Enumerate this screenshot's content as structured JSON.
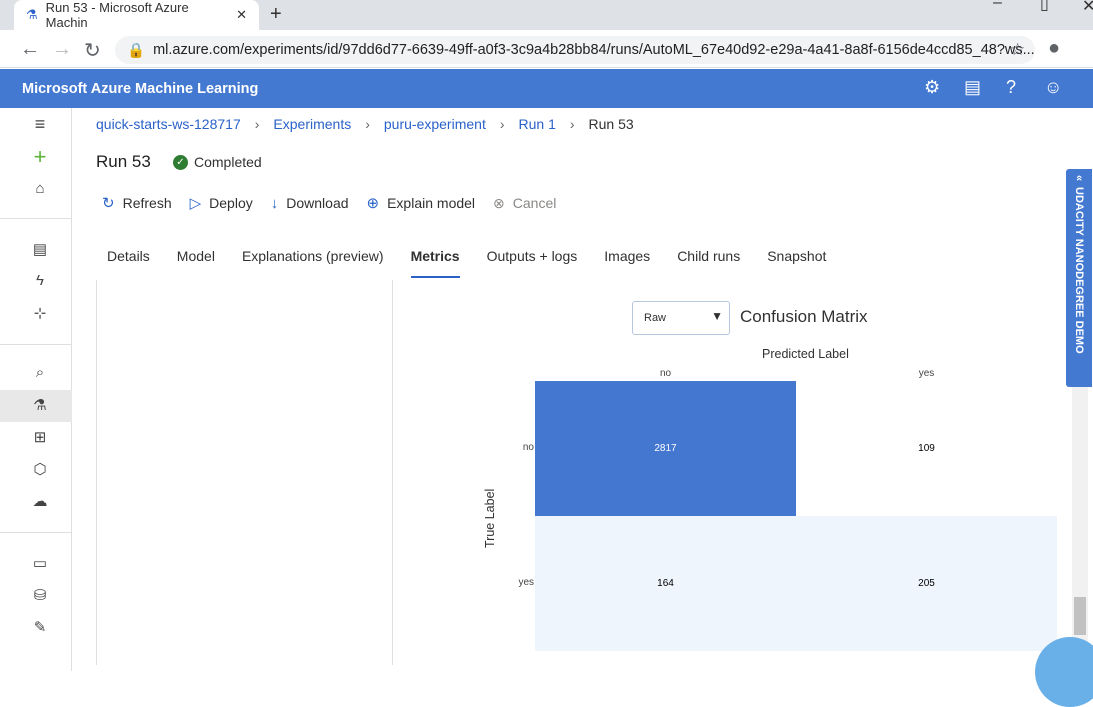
{
  "browser": {
    "tab_title": "Run 53 - Microsoft Azure Machin",
    "url": "ml.azure.com/experiments/id/97dd6d77-6639-49ff-a0f3-3c9a4b28bb84/runs/AutoML_67e40d92-e29a-4a41-8a8f-6156de4ccd85_48?ws..."
  },
  "app": {
    "title": "Microsoft Azure Machine Learning"
  },
  "breadcrumb": [
    "quick-starts-ws-128717",
    "Experiments",
    "puru-experiment",
    "Run 1",
    "Run 53"
  ],
  "run": {
    "title": "Run 53",
    "status": "Completed"
  },
  "toolbar": {
    "refresh": "Refresh",
    "deploy": "Deploy",
    "download": "Download",
    "explain": "Explain model",
    "cancel": "Cancel"
  },
  "tabs": [
    "Details",
    "Model",
    "Explanations (preview)",
    "Metrics",
    "Outputs + logs",
    "Images",
    "Child runs",
    "Snapshot"
  ],
  "select": {
    "value": "Raw"
  },
  "side_banner": "UDACITY NANODEGREE DEMO",
  "chart_data": {
    "type": "heatmap",
    "title": "Confusion Matrix",
    "xlabel": "Predicted Label",
    "ylabel": "True Label",
    "x_categories": [
      "no",
      "yes"
    ],
    "y_categories": [
      "no",
      "yes"
    ],
    "values": [
      [
        2817,
        109
      ],
      [
        164,
        205
      ]
    ],
    "colors": {
      "high": "#4477d0",
      "low": "#eef5fd",
      "mid": "#ffffff"
    }
  }
}
